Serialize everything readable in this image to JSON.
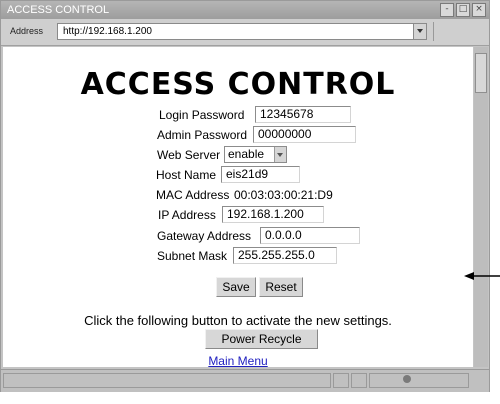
{
  "window": {
    "title": "ACCESS CONTROL",
    "controls": [
      "-",
      "□",
      "×"
    ]
  },
  "addressbar": {
    "label": "Address",
    "url": "http://192.168.1.200"
  },
  "page": {
    "heading": "ACCESS CONTROL",
    "fields": {
      "login_password": {
        "label": "Login Password",
        "value": "12345678"
      },
      "admin_password": {
        "label": "Admin Password",
        "value": "00000000"
      },
      "web_server": {
        "label": "Web Server",
        "value": "enable"
      },
      "host_name": {
        "label": "Host Name",
        "value": "eis21d9"
      },
      "mac_address": {
        "label": "MAC Address",
        "value": "00:03:03:00:21:D9"
      },
      "ip_address": {
        "label": "IP Address",
        "value": "192.168.1.200"
      },
      "gateway_address": {
        "label": "Gateway Address",
        "value": "0.0.0.0"
      },
      "subnet_mask": {
        "label": "Subnet Mask",
        "value": "255.255.255.0"
      }
    },
    "buttons": {
      "save": "Save",
      "reset": "Reset",
      "power_recycle": "Power Recycle"
    },
    "message": "Click the following button to activate the new settings.",
    "main_menu_link": "Main Menu"
  }
}
